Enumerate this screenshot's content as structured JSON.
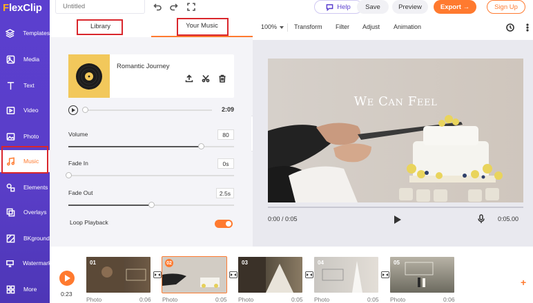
{
  "app": {
    "logo_main": "lexClip",
    "logo_accent": "F"
  },
  "topbar": {
    "title_placeholder": "Untitled",
    "help_label": "Help",
    "save_label": "Save",
    "preview_label": "Preview",
    "export_label": "Export →",
    "signup_label": "Sign Up"
  },
  "sidebar": {
    "items": [
      {
        "label": "Templates",
        "icon": "templates-icon"
      },
      {
        "label": "Media",
        "icon": "media-icon"
      },
      {
        "label": "Text",
        "icon": "text-icon"
      },
      {
        "label": "Video",
        "icon": "video-icon"
      },
      {
        "label": "Photo",
        "icon": "photo-icon"
      },
      {
        "label": "Music",
        "icon": "music-icon",
        "active": true
      },
      {
        "label": "Elements",
        "icon": "elements-icon"
      },
      {
        "label": "Overlays",
        "icon": "overlays-icon"
      },
      {
        "label": "BKground",
        "icon": "background-icon"
      },
      {
        "label": "Watermark",
        "icon": "watermark-icon"
      },
      {
        "label": "More",
        "icon": "more-icon"
      }
    ]
  },
  "music_panel": {
    "tabs": {
      "library": "Library",
      "your_music": "Your Music",
      "active": "your_music"
    },
    "track": {
      "name": "Romantic Journey",
      "duration": "2:09",
      "progress": 0
    },
    "volume": {
      "label": "Volume",
      "value": "80",
      "fraction": 0.8
    },
    "fade_in": {
      "label": "Fade In",
      "value": "0s",
      "fraction": 0
    },
    "fade_out": {
      "label": "Fade Out",
      "value": "2.5s",
      "fraction": 0.5
    },
    "loop": {
      "label": "Loop Playback",
      "on": true
    }
  },
  "editor_toolbar": {
    "zoom": "100%",
    "transform": "Transform",
    "filter": "Filter",
    "adjust": "Adjust",
    "animation": "Animation"
  },
  "preview": {
    "caption": "We Can Feel",
    "current_time": "0:00 / 0:05",
    "duration": "0:05.00"
  },
  "timeline": {
    "time": "0:23",
    "clips": [
      {
        "num": "01",
        "type": "Photo",
        "duration": "0:06"
      },
      {
        "num": "02",
        "type": "Photo",
        "duration": "0:05",
        "selected": true
      },
      {
        "num": "03",
        "type": "Photo",
        "duration": "0:05"
      },
      {
        "num": "04",
        "type": "Photo",
        "duration": "0:05"
      },
      {
        "num": "05",
        "type": "Photo",
        "duration": "0:06"
      }
    ]
  },
  "colors": {
    "brand_purple": "#5b3fcf",
    "accent_orange": "#ff7a2f",
    "annotation_red": "#d9262c"
  }
}
